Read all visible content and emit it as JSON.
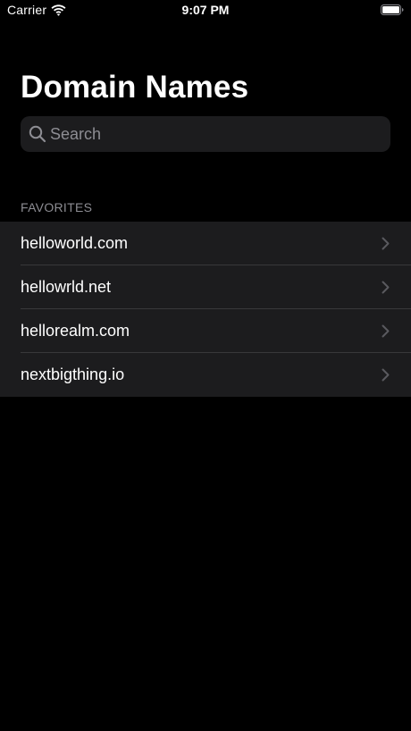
{
  "status_bar": {
    "carrier": "Carrier",
    "time": "9:07 PM",
    "icons": [
      "wifi-icon",
      "battery-icon"
    ]
  },
  "title": "Domain Names",
  "search": {
    "placeholder": "Search",
    "value": "",
    "icon": "search-icon"
  },
  "section": {
    "header": "FAVORITES"
  },
  "items": [
    {
      "label": "helloworld.com",
      "icon": "chevron-right-icon"
    },
    {
      "label": "hellowrld.net",
      "icon": "chevron-right-icon"
    },
    {
      "label": "hellorealm.com",
      "icon": "chevron-right-icon"
    },
    {
      "label": "nextbigthing.io",
      "icon": "chevron-right-icon"
    }
  ],
  "colors": {
    "background": "#000000",
    "cell_background": "#1c1c1e",
    "secondary_text": "#8d8d93",
    "separator": "#38383a",
    "chevron": "#5a5a5f"
  }
}
